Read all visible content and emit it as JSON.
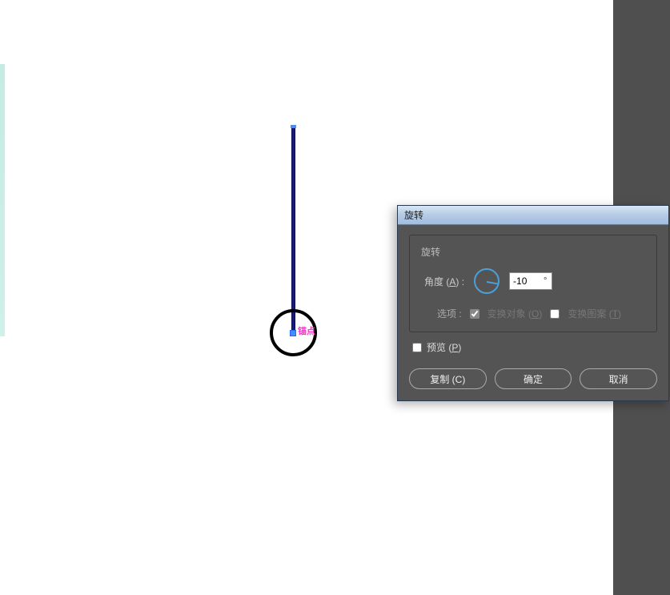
{
  "canvas": {
    "anchor_label": "锚点"
  },
  "dialog": {
    "title": "旋转",
    "group_title": "旋转",
    "angle_label": "角度 (",
    "angle_accel": "A",
    "angle_label_suffix": ") :",
    "angle_value": "-10",
    "degree_symbol": "°",
    "options_label": "选项 :",
    "transform_object_checked": true,
    "transform_object_label": "变换对象 (",
    "transform_object_accel": "O",
    "transform_object_suffix": ")",
    "transform_pattern_checked": false,
    "transform_pattern_label": "变换图案 (",
    "transform_pattern_accel": "T",
    "transform_pattern_suffix": ")",
    "preview_checked": false,
    "preview_label": "预览 (",
    "preview_accel": "P",
    "preview_suffix": ")",
    "buttons": {
      "copy": "复制 (C)",
      "ok": "确定",
      "cancel": "取消"
    }
  }
}
